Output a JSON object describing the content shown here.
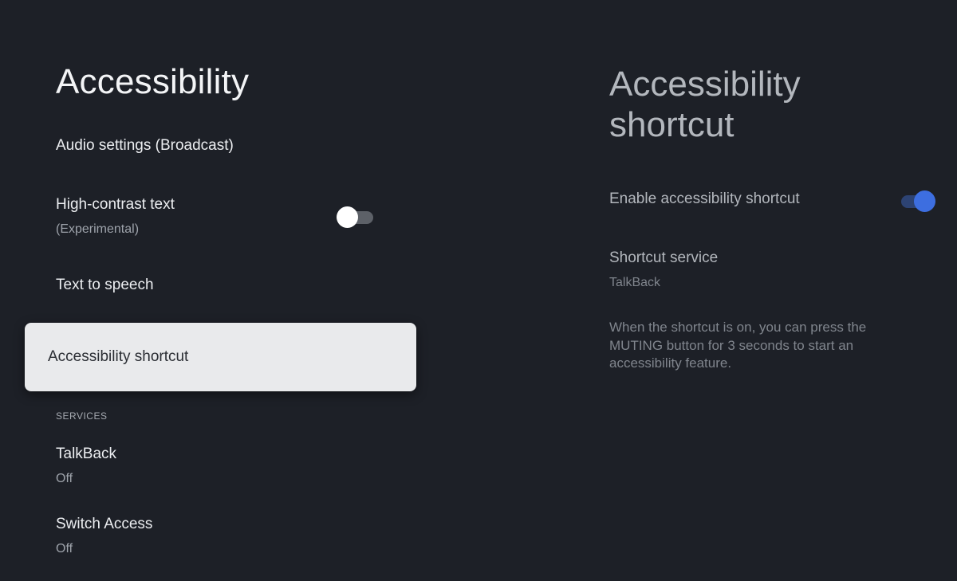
{
  "left_pane": {
    "title": "Accessibility",
    "items": [
      {
        "label": "Audio settings (Broadcast)"
      },
      {
        "label": "High-contrast text",
        "subtitle": "(Experimental)",
        "toggle": "off"
      },
      {
        "label": "Text to speech"
      },
      {
        "label": "Accessibility shortcut",
        "selected": true
      }
    ],
    "section_header": "SERVICES",
    "services": [
      {
        "label": "TalkBack",
        "subtitle": "Off"
      },
      {
        "label": "Switch Access",
        "subtitle": "Off"
      }
    ]
  },
  "right_pane": {
    "title": "Accessibility shortcut",
    "enable_shortcut": {
      "label": "Enable accessibility shortcut",
      "toggle": "on"
    },
    "shortcut_service": {
      "label": "Shortcut service",
      "value": "TalkBack"
    },
    "description": "When the shortcut is on, you can press the MUTING button for 3 seconds to start an accessibility feature."
  },
  "colors": {
    "background": "#1d2027",
    "selected_background": "#e9eaec",
    "toggle_on_accent": "#3d6ee0"
  }
}
